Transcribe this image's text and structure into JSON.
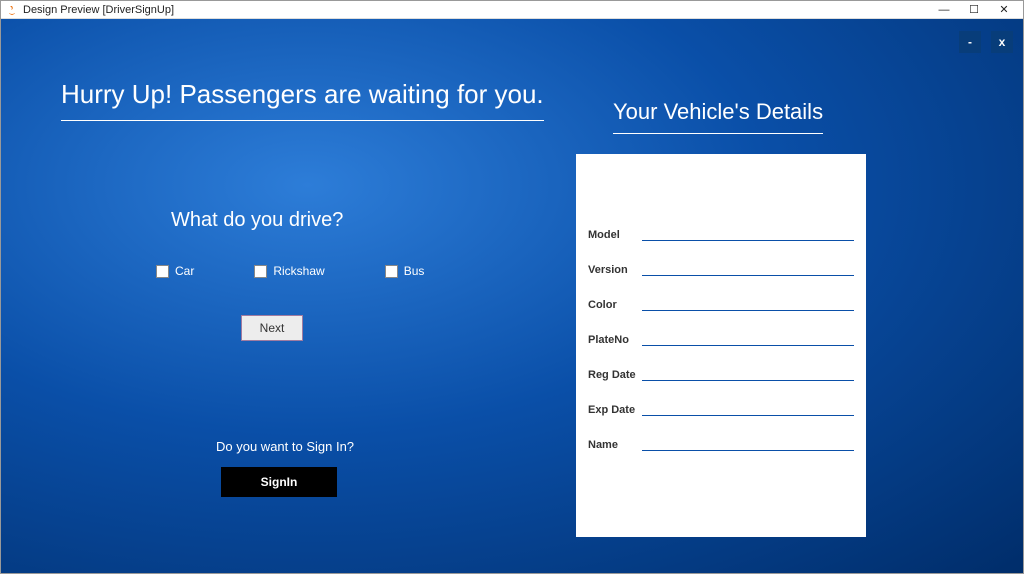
{
  "titlebar": {
    "title": "Design Preview [DriverSignUp]",
    "minimize": "—",
    "maximize": "☐",
    "close": "✕"
  },
  "innerControls": {
    "minimize": "-",
    "close": "x"
  },
  "headline": "Hurry Up! Passengers are waiting for you.",
  "question": "What do you drive?",
  "vehicleTypes": {
    "car": "Car",
    "rickshaw": "Rickshaw",
    "bus": "Bus"
  },
  "buttons": {
    "next": "Next",
    "signin": "SignIn"
  },
  "signinPrompt": "Do you want to Sign In?",
  "vehicleDetailsTitle": "Your Vehicle's Details",
  "formLabels": {
    "model": "Model",
    "version": "Version",
    "color": "Color",
    "plateNo": "PlateNo",
    "regDate": "Reg Date",
    "expDate": "Exp Date",
    "name": "Name"
  },
  "formValues": {
    "model": "",
    "version": "",
    "color": "",
    "plateNo": "",
    "regDate": "",
    "expDate": "",
    "name": ""
  }
}
